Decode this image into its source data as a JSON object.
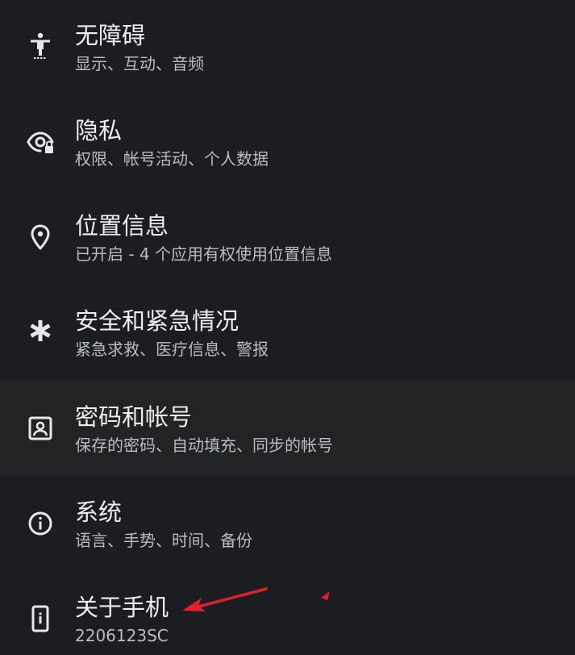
{
  "settings": {
    "items": [
      {
        "title": "无障碍",
        "subtitle": "显示、互动、音频",
        "icon": "accessibility-icon"
      },
      {
        "title": "隐私",
        "subtitle": "权限、帐号活动、个人数据",
        "icon": "privacy-eye-lock-icon"
      },
      {
        "title": "位置信息",
        "subtitle": "已开启 - 4 个应用有权使用位置信息",
        "icon": "location-pin-icon"
      },
      {
        "title": "安全和紧急情况",
        "subtitle": "紧急求救、医疗信息、警报",
        "icon": "asterisk-icon"
      },
      {
        "title": "密码和帐号",
        "subtitle": "保存的密码、自动填充、同步的帐号",
        "icon": "account-box-icon"
      },
      {
        "title": "系统",
        "subtitle": "语言、手势、时间、备份",
        "icon": "info-icon"
      },
      {
        "title": "关于手机",
        "subtitle": "2206123SC",
        "icon": "phone-info-icon"
      }
    ]
  },
  "colors": {
    "background": "#1b1d20",
    "highlight_row": "#212325",
    "title_text": "#eceef0",
    "subtitle_text": "#b9bcc0",
    "annotation_arrow": "#e0202a"
  }
}
